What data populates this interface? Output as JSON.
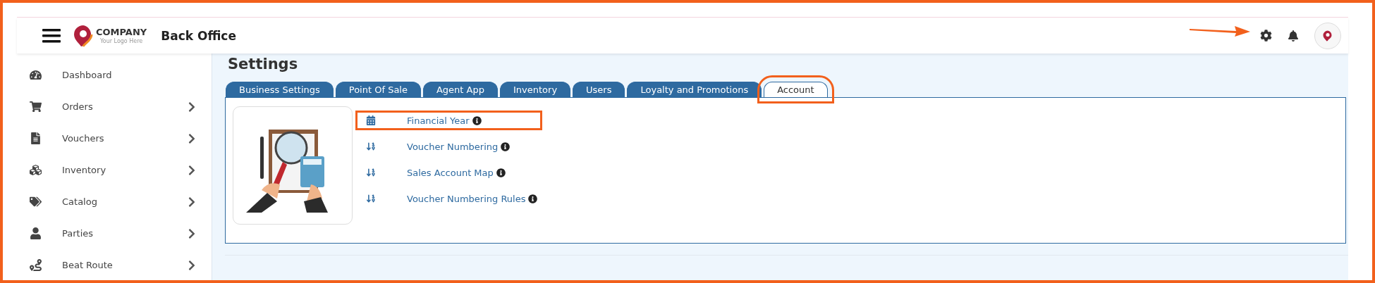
{
  "annotation_frame": true,
  "header": {
    "logo": {
      "name": "COMPANY",
      "tagline": "Your Logo Here"
    },
    "title": "Back Office",
    "settings_arrow": true
  },
  "sidebar": {
    "items": [
      {
        "label": "Dashboard",
        "has_children": false
      },
      {
        "label": "Orders",
        "has_children": true
      },
      {
        "label": "Vouchers",
        "has_children": true
      },
      {
        "label": "Inventory",
        "has_children": true
      },
      {
        "label": "Catalog",
        "has_children": true
      },
      {
        "label": "Parties",
        "has_children": true
      },
      {
        "label": "Beat Route",
        "has_children": true
      }
    ]
  },
  "page": {
    "title": "Settings",
    "tabs": [
      {
        "label": "Business Settings",
        "selected": false,
        "highlighted": false
      },
      {
        "label": "Point Of Sale",
        "selected": false,
        "highlighted": false
      },
      {
        "label": "Agent App",
        "selected": false,
        "highlighted": false
      },
      {
        "label": "Inventory",
        "selected": false,
        "highlighted": false
      },
      {
        "label": "Users",
        "selected": false,
        "highlighted": false
      },
      {
        "label": "Loyalty and Promotions",
        "selected": false,
        "highlighted": false
      },
      {
        "label": "Account",
        "selected": true,
        "highlighted": true
      }
    ],
    "items": [
      {
        "label": "Financial Year",
        "highlighted": true
      },
      {
        "label": "Voucher Numbering",
        "highlighted": false
      },
      {
        "label": "Sales Account Map",
        "highlighted": false
      },
      {
        "label": "Voucher Numbering Rules",
        "highlighted": false
      }
    ]
  }
}
